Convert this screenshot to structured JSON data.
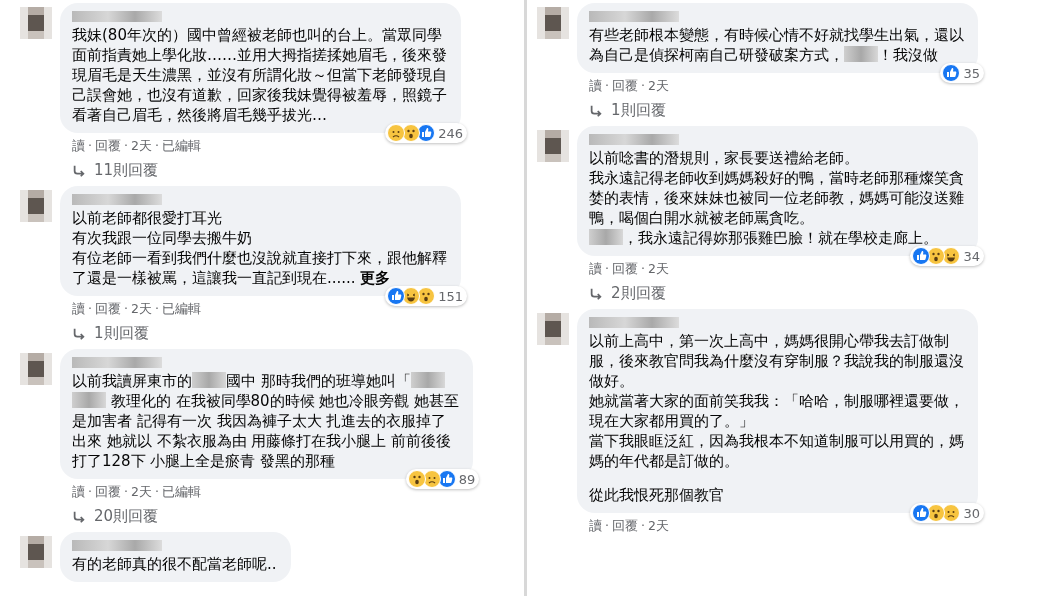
{
  "separator": "·",
  "columns": [
    {
      "comments": [
        {
          "paragraphs": [
            [
              "我妹(80年次的）國中曾經被老師也叫的台上。當眾同學",
              "面前指責她上學化妝……並用大拇指搓揉她眉毛，後來發",
              "現眉毛是天生濃黑，並沒有所謂化妝～但當下老師發現自",
              "己誤會她，也沒有道歉，回家後我妹覺得被羞辱，照鏡子",
              "看著自己眉毛，然後將眉毛幾乎拔光…"
            ]
          ],
          "reactions": [
            {
              "kind": "sad"
            },
            {
              "kind": "wow"
            },
            {
              "kind": "like"
            }
          ],
          "reaction_count": "246",
          "actions": [
            "讀",
            "回覆",
            "2天",
            "已編輯"
          ],
          "replies": "11則回覆"
        },
        {
          "paragraphs": [
            [
              "以前老師都很愛打耳光",
              "有次我跟一位同學去搬牛奶",
              "有位老師一看到我們什麼也沒說就直接打下來，跟他解釋",
              [
                {
                  "kind": "text",
                  "text": "了還是一樣被罵，這讓我一直記到現在......"
                },
                {
                  "kind": "link",
                  "text": "更多"
                }
              ]
            ]
          ],
          "reactions": [
            {
              "kind": "like"
            },
            {
              "kind": "haha"
            },
            {
              "kind": "wow"
            }
          ],
          "reaction_count": "151",
          "actions": [
            "讀",
            "回覆",
            "2天",
            "已編輯"
          ],
          "replies": "1則回覆"
        },
        {
          "paragraphs": [
            [
              [
                {
                  "kind": "text",
                  "text": "以前我讀屏東市的"
                },
                {
                  "kind": "redacted"
                },
                {
                  "kind": "text",
                  "text": "國中 那時我們的班導她叫「"
                },
                {
                  "kind": "redacted"
                }
              ],
              [
                {
                  "kind": "redacted"
                },
                {
                  "kind": "text",
                  "text": " 教理化的 在我被同學80的時候 她也冷眼旁觀 她甚至"
                }
              ],
              "是加害者 記得有一次 我因為褲子太大 扎進去的衣服掉了",
              "出來 她就以 不紮衣服為由 用藤條打在我小腿上 前前後後",
              "打了128下 小腿上全是瘀青 發黑的那種"
            ]
          ],
          "reactions": [
            {
              "kind": "wow"
            },
            {
              "kind": "sad"
            },
            {
              "kind": "like"
            }
          ],
          "reaction_count": "89",
          "actions": [
            "讀",
            "回覆",
            "2天",
            "已編輯"
          ],
          "replies": "20則回覆"
        },
        {
          "paragraphs": [
            [
              "有的老師真的很不配當老師呢.."
            ]
          ]
        }
      ]
    },
    {
      "comments": [
        {
          "paragraphs": [
            [
              "有些老師根本變態，有時候心情不好就找學生出氣，還以",
              [
                {
                  "kind": "text",
                  "text": "為自己是偵探柯南自己研發破案方式，"
                },
                {
                  "kind": "redacted"
                },
                {
                  "kind": "text",
                  "text": "！我沒做"
                }
              ]
            ]
          ],
          "reactions": [
            {
              "kind": "like"
            }
          ],
          "reaction_count": "35",
          "actions": [
            "讀",
            "回覆",
            "2天"
          ],
          "replies": "1則回覆"
        },
        {
          "paragraphs": [
            [
              "以前唸書的潛規則，家長要送禮給老師。",
              "我永遠記得老師收到媽媽殺好的鴨，當時老師那種燦笑貪",
              "婪的表情，後來妹妹也被同一位老師教，媽媽可能沒送雞",
              "鴨，喝個白開水就被老師罵貪吃。",
              [
                {
                  "kind": "redacted"
                },
                {
                  "kind": "text",
                  "text": "，我永遠記得妳那張雞巴臉！就在學校走廊上。"
                }
              ]
            ]
          ],
          "reactions": [
            {
              "kind": "like"
            },
            {
              "kind": "wow"
            },
            {
              "kind": "haha"
            }
          ],
          "reaction_count": "34",
          "actions": [
            "讀",
            "回覆",
            "2天"
          ],
          "replies": "2則回覆"
        },
        {
          "paragraphs": [
            [
              "以前上高中，第一次上高中，媽媽很開心帶我去訂做制",
              "服，後來教官問我為什麼沒有穿制服？我說我的制服還沒",
              "做好。",
              "她就當著大家的面前笑我我：「哈哈，制服哪裡還要做，",
              "現在大家都用買的了。」",
              "當下我眼眶泛紅，因為我根本不知道制服可以用買的，媽",
              "媽的年代都是訂做的。"
            ],
            [
              "從此我恨死那個教官"
            ]
          ],
          "reactions": [
            {
              "kind": "like"
            },
            {
              "kind": "wow"
            },
            {
              "kind": "sad"
            }
          ],
          "reaction_count": "30",
          "actions": [
            "讀",
            "回覆",
            "2天"
          ]
        }
      ]
    }
  ]
}
